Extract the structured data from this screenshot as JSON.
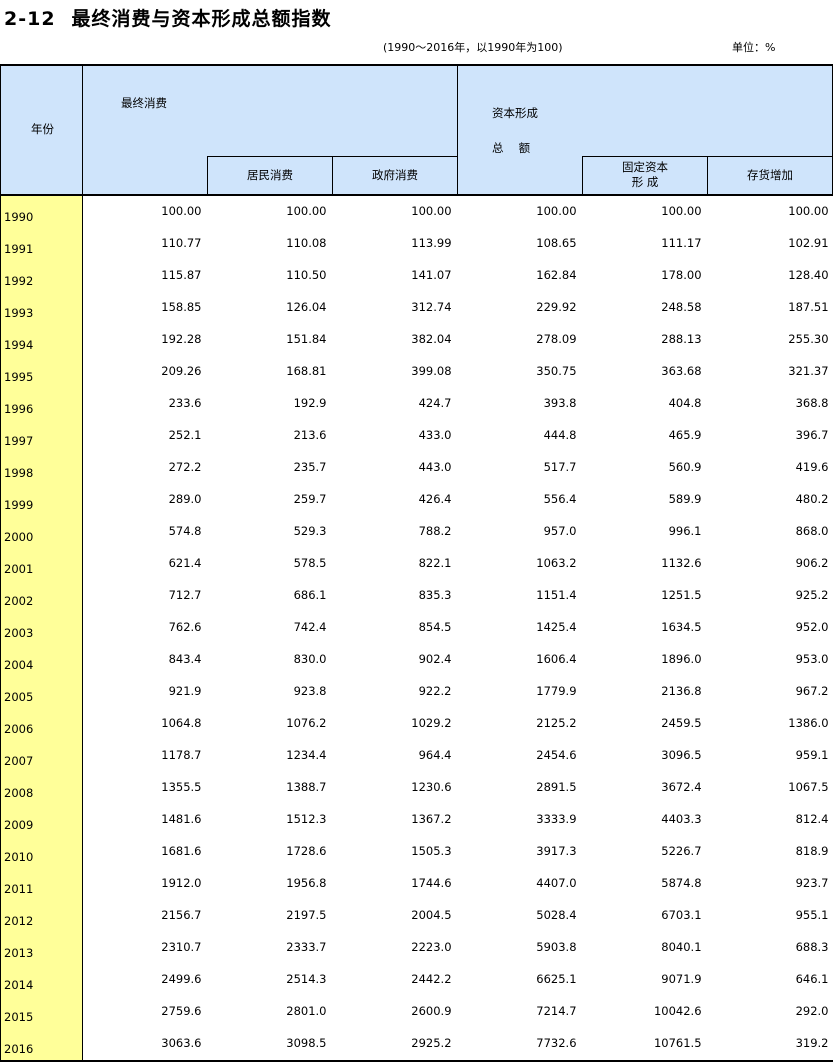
{
  "header": {
    "table_number": "2-12",
    "title": "最终消费与资本形成总额指数",
    "subtitle": "(1990～2016年，以1990年为100)",
    "unit": "单位：%"
  },
  "columns": {
    "year": "年份",
    "final_consumption": "最终消费",
    "household_consumption": "居民消费",
    "government_consumption": "政府消费",
    "capital_formation_line1": "资本形成",
    "capital_formation_line2": "总　 额",
    "fixed_capital_line1": "固定资本",
    "fixed_capital_line2": "形  成",
    "inventory_increase": "存货增加"
  },
  "rows": [
    [
      "1990",
      "100.00",
      "100.00",
      "100.00",
      "100.00",
      "100.00",
      "100.00"
    ],
    [
      "1991",
      "110.77",
      "110.08",
      "113.99",
      "108.65",
      "111.17",
      "102.91"
    ],
    [
      "1992",
      "115.87",
      "110.50",
      "141.07",
      "162.84",
      "178.00",
      "128.40"
    ],
    [
      "1993",
      "158.85",
      "126.04",
      "312.74",
      "229.92",
      "248.58",
      "187.51"
    ],
    [
      "1994",
      "192.28",
      "151.84",
      "382.04",
      "278.09",
      "288.13",
      "255.30"
    ],
    [
      "1995",
      "209.26",
      "168.81",
      "399.08",
      "350.75",
      "363.68",
      "321.37"
    ],
    [
      "1996",
      "233.6",
      "192.9",
      "424.7",
      "393.8",
      "404.8",
      "368.8"
    ],
    [
      "1997",
      "252.1",
      "213.6",
      "433.0",
      "444.8",
      "465.9",
      "396.7"
    ],
    [
      "1998",
      "272.2",
      "235.7",
      "443.0",
      "517.7",
      "560.9",
      "419.6"
    ],
    [
      "1999",
      "289.0",
      "259.7",
      "426.4",
      "556.4",
      "589.9",
      "480.2"
    ],
    [
      "2000",
      "574.8",
      "529.3",
      "788.2",
      "957.0",
      "996.1",
      "868.0"
    ],
    [
      "2001",
      "621.4",
      "578.5",
      "822.1",
      "1063.2",
      "1132.6",
      "906.2"
    ],
    [
      "2002",
      "712.7",
      "686.1",
      "835.3",
      "1151.4",
      "1251.5",
      "925.2"
    ],
    [
      "2003",
      "762.6",
      "742.4",
      "854.5",
      "1425.4",
      "1634.5",
      "952.0"
    ],
    [
      "2004",
      "843.4",
      "830.0",
      "902.4",
      "1606.4",
      "1896.0",
      "953.0"
    ],
    [
      "2005",
      "921.9",
      "923.8",
      "922.2",
      "1779.9",
      "2136.8",
      "967.2"
    ],
    [
      "2006",
      "1064.8",
      "1076.2",
      "1029.2",
      "2125.2",
      "2459.5",
      "1386.0"
    ],
    [
      "2007",
      "1178.7",
      "1234.4",
      "964.4",
      "2454.6",
      "3096.5",
      "959.1"
    ],
    [
      "2008",
      "1355.5",
      "1388.7",
      "1230.6",
      "2891.5",
      "3672.4",
      "1067.5"
    ],
    [
      "2009",
      "1481.6",
      "1512.3",
      "1367.2",
      "3333.9",
      "4403.3",
      "812.4"
    ],
    [
      "2010",
      "1681.6",
      "1728.6",
      "1505.3",
      "3917.3",
      "5226.7",
      "818.9"
    ],
    [
      "2011",
      "1912.0",
      "1956.8",
      "1744.6",
      "4407.0",
      "5874.8",
      "923.7"
    ],
    [
      "2012",
      "2156.7",
      "2197.5",
      "2004.5",
      "5028.4",
      "6703.1",
      "955.1"
    ],
    [
      "2013",
      "2310.7",
      "2333.7",
      "2223.0",
      "5903.8",
      "8040.1",
      "688.3"
    ],
    [
      "2014",
      "2499.6",
      "2514.3",
      "2442.2",
      "6625.1",
      "9071.9",
      "646.1"
    ],
    [
      "2015",
      "2759.6",
      "2801.0",
      "2600.9",
      "7214.7",
      "10042.6",
      "292.0"
    ],
    [
      "2016",
      "3063.6",
      "3098.5",
      "2925.2",
      "7732.6",
      "10761.5",
      "319.2"
    ]
  ]
}
